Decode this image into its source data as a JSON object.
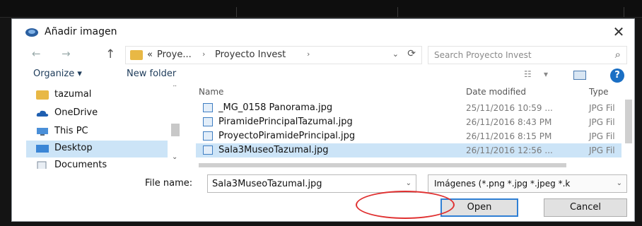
{
  "dialog": {
    "title": "Añadir imagen",
    "close_glyph": "✕"
  },
  "nav": {
    "back_glyph": "←",
    "forward_glyph": "→",
    "up_glyph": "↑",
    "address": {
      "overflow": "«",
      "crumbs": [
        "Proye...",
        "Proyecto Invest"
      ],
      "sep": "›",
      "dropdown_glyph": "⌄",
      "refresh_glyph": "⟳"
    },
    "search": {
      "placeholder": "Search Proyecto Invest",
      "icon_glyph": "⌕"
    }
  },
  "toolbar": {
    "organize": "Organize ▾",
    "new_folder": "New folder",
    "view_glyph": "☷",
    "view_drop": "▾",
    "help_glyph": "?"
  },
  "sidebar": {
    "items": [
      {
        "label": "tazumal",
        "icon": "folder-icon"
      },
      {
        "label": "OneDrive",
        "icon": "cloud-icon"
      },
      {
        "label": "This PC",
        "icon": "computer-icon"
      },
      {
        "label": "Desktop",
        "icon": "desktop-icon",
        "selected": true
      },
      {
        "label": "Documents",
        "icon": "documents-icon"
      }
    ],
    "scroll_up": "⌃",
    "scroll_down": "⌄"
  },
  "files": {
    "sort_glyph": "⌃",
    "columns": {
      "name": "Name",
      "date": "Date modified",
      "type": "Type"
    },
    "rows": [
      {
        "name": "_MG_0158 Panorama.jpg",
        "date": "25/11/2016 10:59 ...",
        "type": "JPG Fil"
      },
      {
        "name": "PiramidePrincipalTazumal.jpg",
        "date": "26/11/2016 8:43 PM",
        "type": "JPG Fil"
      },
      {
        "name": "ProyectoPiramidePrincipal.jpg",
        "date": "26/11/2016 8:15 PM",
        "type": "JPG Fil"
      },
      {
        "name": "Sala3MuseoTazumal.jpg",
        "date": "26/11/2016 12:56 ...",
        "type": "JPG Fil",
        "selected": true
      }
    ],
    "scroll_left": "‹",
    "scroll_right": "›"
  },
  "bottom": {
    "filename_label": "File name:",
    "filename_value": "Sala3MuseoTazumal.jpg",
    "filetype_value": "Imágenes (*.png *.jpg *.jpeg *.k",
    "drop_glyph": "⌄",
    "open": "Open",
    "cancel": "Cancel"
  },
  "colors": {
    "selection": "#cce4f7",
    "primary_border": "#2f7fd4",
    "annotation": "#e03030",
    "folder": "#e8b845"
  }
}
